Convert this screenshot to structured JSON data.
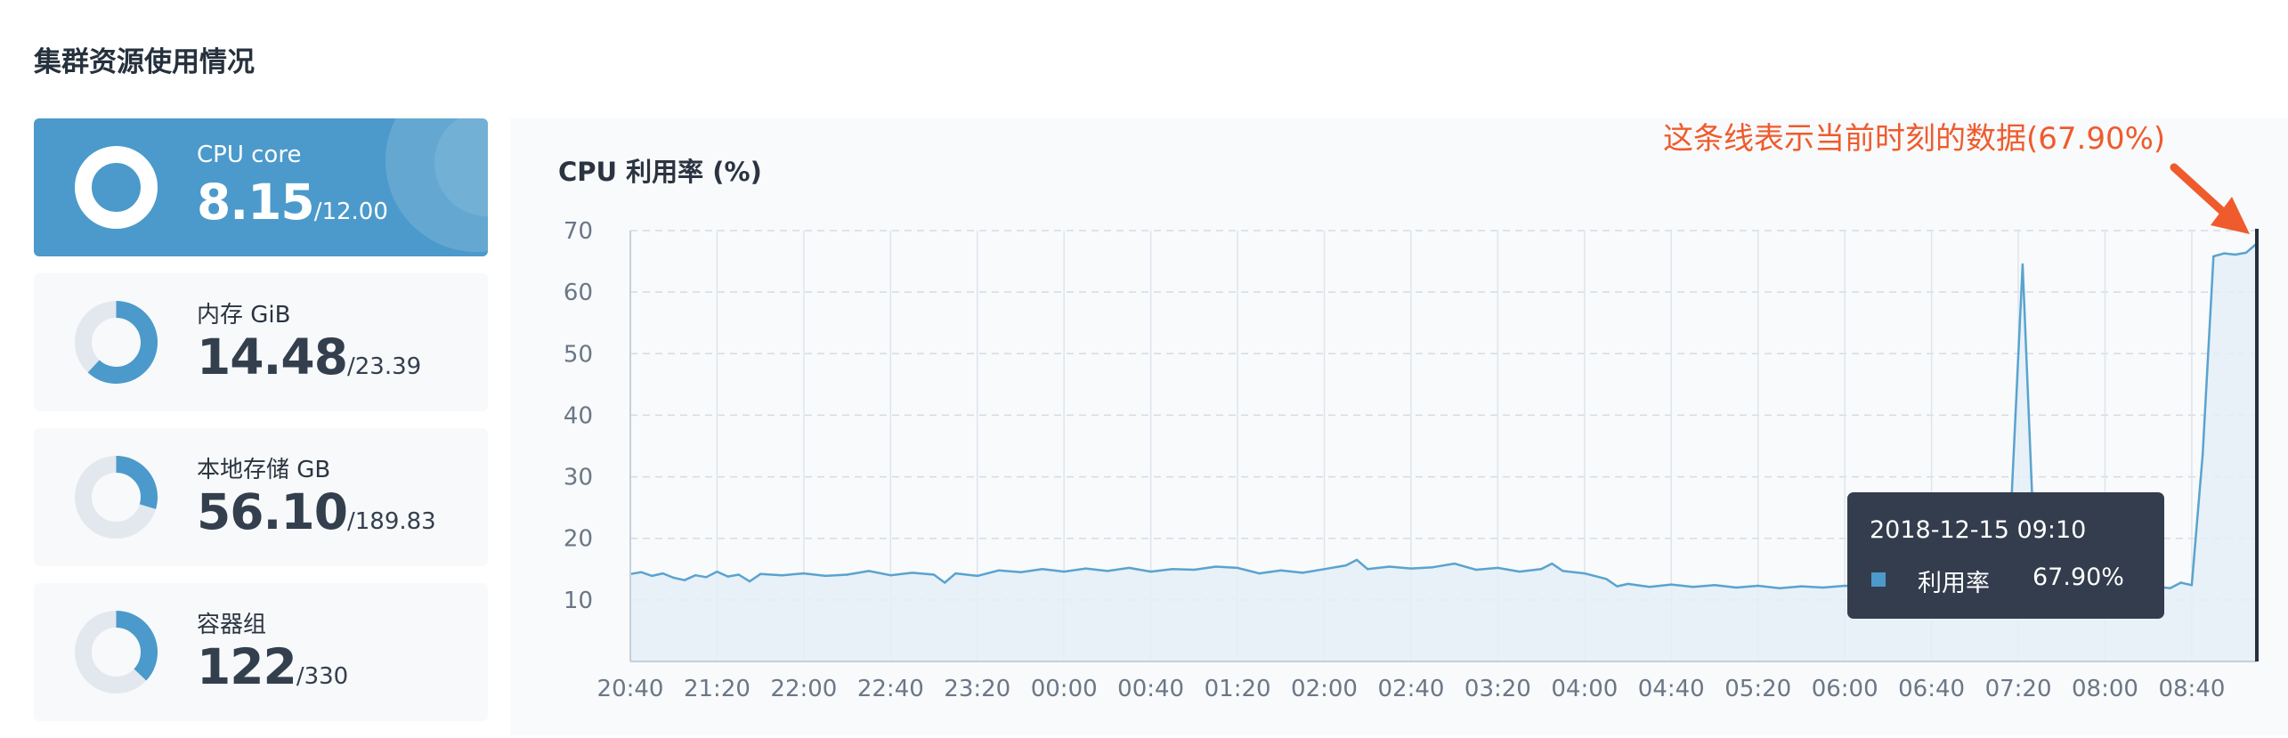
{
  "page": {
    "title": "集群资源使用情况"
  },
  "cards": [
    {
      "label": "CPU core",
      "value": "8.15",
      "total": "/12.00",
      "ratio": 0.679,
      "active": true
    },
    {
      "label": "内存 GiB",
      "value": "14.48",
      "total": "/23.39",
      "ratio": 0.619,
      "active": false
    },
    {
      "label": "本地存储 GB",
      "value": "56.10",
      "total": "/189.83",
      "ratio": 0.296,
      "active": false
    },
    {
      "label": "容器组",
      "value": "122",
      "total": "/330",
      "ratio": 0.37,
      "active": false
    }
  ],
  "annotation": {
    "text": "这条线表示当前时刻的数据(67.90%)"
  },
  "tooltip": {
    "time": "2018-12-15 09:10",
    "series_name": "利用率",
    "value": "67.90%"
  },
  "colors": {
    "accent": "#4b9acb",
    "line": "#5aa3cf",
    "area": "#e4eff6",
    "annotation": "#ef5b2c",
    "tooltip_bg": "#333d4d",
    "donut_track": "#e3e8ee"
  },
  "chart_data": {
    "type": "area",
    "title": "CPU 利用率 (%)",
    "ylim": [
      0,
      70
    ],
    "y_ticks": [
      10,
      20,
      30,
      40,
      50,
      60,
      70
    ],
    "x_ticks": [
      "20:40",
      "21:20",
      "22:00",
      "22:40",
      "23:20",
      "00:00",
      "00:40",
      "01:20",
      "02:00",
      "02:40",
      "03:20",
      "04:00",
      "04:40",
      "05:20",
      "06:00",
      "06:40",
      "07:20",
      "08:00",
      "08:40"
    ],
    "grid": true,
    "current_marker": "09:10",
    "series": [
      {
        "name": "利用率",
        "points": [
          [
            "20:40",
            14.2
          ],
          [
            "20:45",
            14.5
          ],
          [
            "20:50",
            13.9
          ],
          [
            "20:55",
            14.3
          ],
          [
            "21:00",
            13.6
          ],
          [
            "21:05",
            13.2
          ],
          [
            "21:10",
            14.0
          ],
          [
            "21:15",
            13.7
          ],
          [
            "21:20",
            14.6
          ],
          [
            "21:25",
            13.8
          ],
          [
            "21:30",
            14.1
          ],
          [
            "21:35",
            13.0
          ],
          [
            "21:40",
            14.2
          ],
          [
            "21:50",
            14.0
          ],
          [
            "22:00",
            14.3
          ],
          [
            "22:10",
            13.9
          ],
          [
            "22:20",
            14.1
          ],
          [
            "22:30",
            14.7
          ],
          [
            "22:40",
            14.0
          ],
          [
            "22:50",
            14.4
          ],
          [
            "23:00",
            14.1
          ],
          [
            "23:05",
            12.8
          ],
          [
            "23:10",
            14.3
          ],
          [
            "23:20",
            13.9
          ],
          [
            "23:30",
            14.8
          ],
          [
            "23:40",
            14.5
          ],
          [
            "23:50",
            15.0
          ],
          [
            "00:00",
            14.6
          ],
          [
            "00:10",
            15.1
          ],
          [
            "00:20",
            14.7
          ],
          [
            "00:30",
            15.2
          ],
          [
            "00:40",
            14.6
          ],
          [
            "00:50",
            15.0
          ],
          [
            "01:00",
            14.9
          ],
          [
            "01:10",
            15.4
          ],
          [
            "01:20",
            15.2
          ],
          [
            "01:30",
            14.3
          ],
          [
            "01:40",
            14.8
          ],
          [
            "01:50",
            14.4
          ],
          [
            "02:00",
            15.0
          ],
          [
            "02:10",
            15.6
          ],
          [
            "02:15",
            16.5
          ],
          [
            "02:20",
            15.0
          ],
          [
            "02:30",
            15.4
          ],
          [
            "02:40",
            15.1
          ],
          [
            "02:50",
            15.3
          ],
          [
            "03:00",
            15.9
          ],
          [
            "03:10",
            14.9
          ],
          [
            "03:20",
            15.2
          ],
          [
            "03:30",
            14.6
          ],
          [
            "03:40",
            15.0
          ],
          [
            "03:45",
            15.9
          ],
          [
            "03:50",
            14.7
          ],
          [
            "04:00",
            14.3
          ],
          [
            "04:10",
            13.4
          ],
          [
            "04:15",
            12.2
          ],
          [
            "04:20",
            12.6
          ],
          [
            "04:30",
            12.1
          ],
          [
            "04:40",
            12.5
          ],
          [
            "04:50",
            12.1
          ],
          [
            "05:00",
            12.4
          ],
          [
            "05:10",
            12.0
          ],
          [
            "05:20",
            12.3
          ],
          [
            "05:30",
            11.9
          ],
          [
            "05:40",
            12.2
          ],
          [
            "05:50",
            12.0
          ],
          [
            "06:00",
            12.3
          ],
          [
            "06:20",
            12.1
          ],
          [
            "06:40",
            12.4
          ],
          [
            "07:00",
            12.3
          ],
          [
            "07:10",
            12.6
          ],
          [
            "07:15",
            12.4
          ],
          [
            "07:22",
            64.5
          ],
          [
            "07:28",
            13.2
          ],
          [
            "07:40",
            12.4
          ],
          [
            "08:00",
            12.1
          ],
          [
            "08:20",
            12.3
          ],
          [
            "08:30",
            11.9
          ],
          [
            "08:35",
            12.8
          ],
          [
            "08:40",
            12.4
          ],
          [
            "08:45",
            33.5
          ],
          [
            "08:50",
            65.8
          ],
          [
            "08:55",
            66.3
          ],
          [
            "09:00",
            66.1
          ],
          [
            "09:05",
            66.4
          ],
          [
            "09:10",
            67.9
          ]
        ]
      }
    ]
  }
}
